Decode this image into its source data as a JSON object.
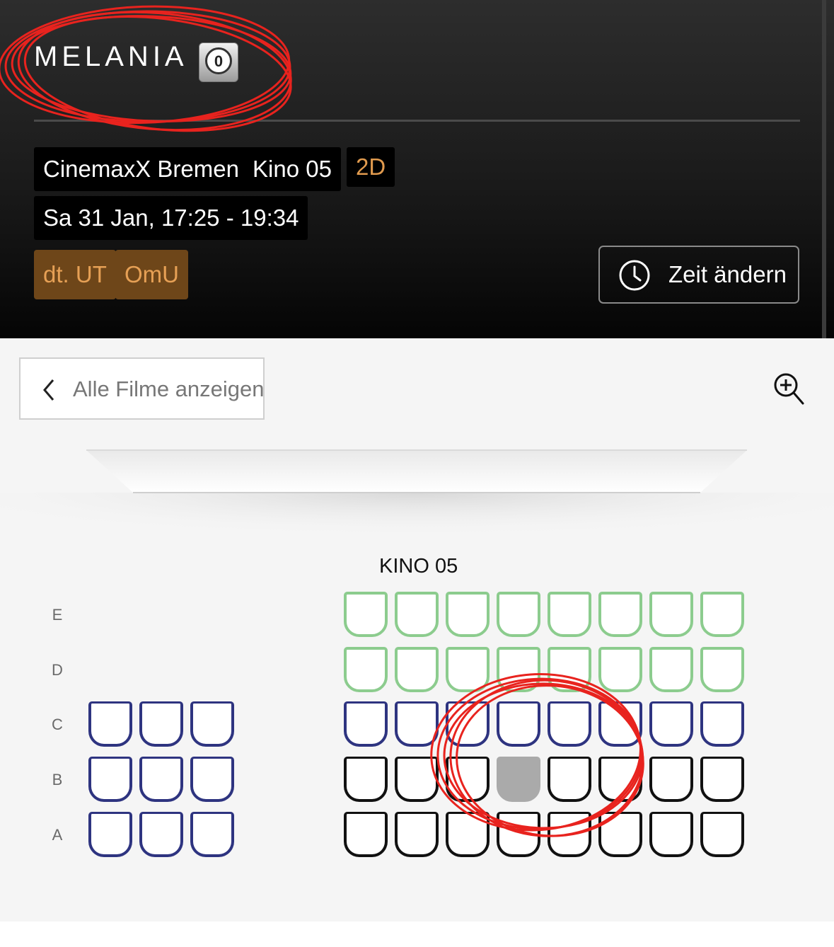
{
  "movie": {
    "title": "MELANIA",
    "rating_icon": "fsk-0-rating-icon",
    "rating_value": "0"
  },
  "details": {
    "cinema": "CinemaxX Bremen",
    "hall": "Kino 05",
    "format": "2D",
    "datetime": "Sa 31 Jan, 17:25 - 19:34",
    "tags": [
      "dt. UT",
      "OmU"
    ]
  },
  "change_time_button": {
    "label": "Zeit ändern",
    "icon": "clock-icon"
  },
  "back_button": {
    "label": "Alle Filme anzeigen",
    "icon": "chevron-left-icon"
  },
  "zoom_icon": "zoom-in-icon",
  "seat_map": {
    "hall_label": "KINO 05",
    "row_labels": [
      "E",
      "D",
      "C",
      "B",
      "A"
    ],
    "rows": [
      {
        "row": "E",
        "left": [],
        "right": [
          "wheelchair",
          "wheelchair",
          "wheelchair",
          "wheelchair",
          "wheelchair",
          "wheelchair",
          "wheelchair",
          "wheelchair"
        ]
      },
      {
        "row": "D",
        "left": [],
        "right": [
          "wheelchair",
          "wheelchair",
          "wheelchair",
          "wheelchair",
          "wheelchair",
          "wheelchair",
          "wheelchair",
          "wheelchair"
        ]
      },
      {
        "row": "C",
        "left": [
          "premium",
          "premium",
          "premium"
        ],
        "right": [
          "premium",
          "premium",
          "premium",
          "premium",
          "premium",
          "premium",
          "premium",
          "premium"
        ]
      },
      {
        "row": "B",
        "left": [
          "premium",
          "premium",
          "premium"
        ],
        "right": [
          "free",
          "free",
          "free",
          "taken",
          "free",
          "free",
          "free",
          "free"
        ]
      },
      {
        "row": "A",
        "left": [
          "premium",
          "premium",
          "premium"
        ],
        "right": [
          "free",
          "free",
          "free",
          "free",
          "free",
          "free",
          "free",
          "free"
        ]
      }
    ],
    "colors": {
      "wheelchair": "#8ccc8e",
      "premium": "#2e3480",
      "free": "#111111",
      "taken": "#aaaaaa"
    }
  },
  "annotation_color": "#e8231e"
}
